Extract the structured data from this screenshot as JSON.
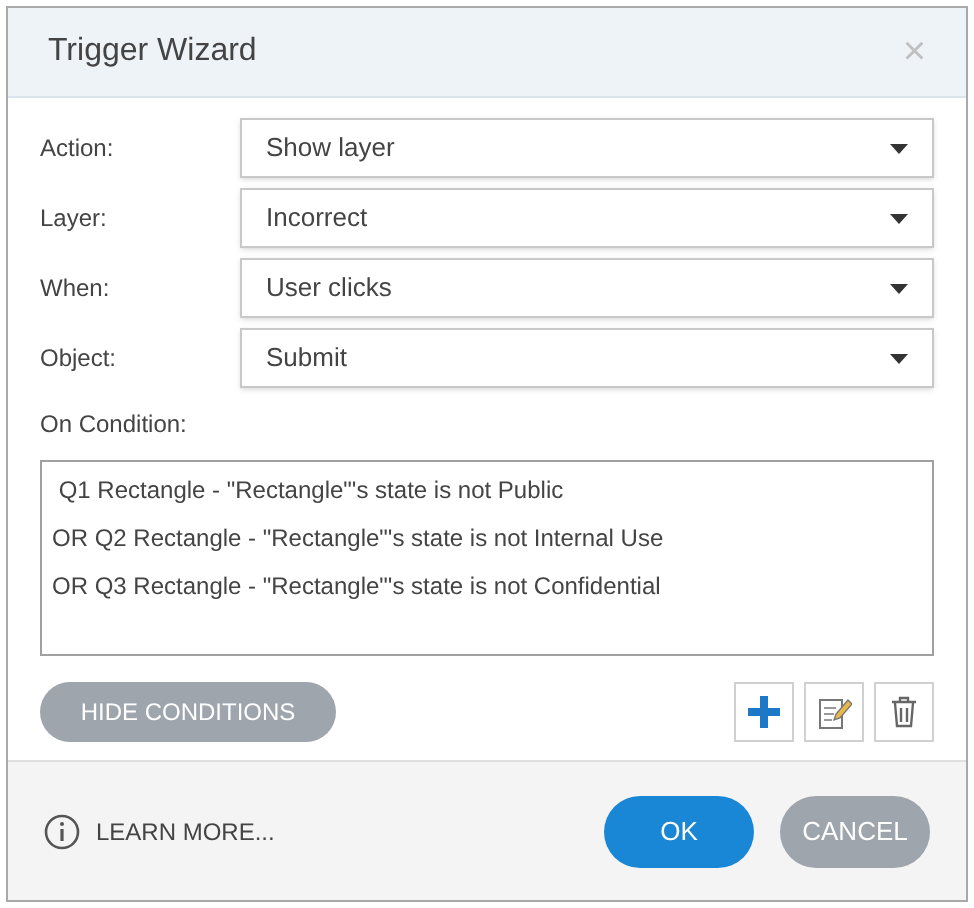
{
  "window": {
    "title": "Trigger Wizard",
    "close": "×"
  },
  "fields": [
    {
      "label": "Action:",
      "value": "Show layer"
    },
    {
      "label": "Layer:",
      "value": "Incorrect"
    },
    {
      "label": "When:",
      "value": "User clicks"
    },
    {
      "label": "Object:",
      "value": "Submit"
    }
  ],
  "conditions": {
    "label": "On Condition:",
    "items": [
      " Q1 Rectangle - \"Rectangle\"'s state is not Public",
      "OR Q2 Rectangle - \"Rectangle\"'s state is not Internal Use",
      "OR Q3 Rectangle - \"Rectangle\"'s state is not Confidential"
    ]
  },
  "hide_conditions": "HIDE CONDITIONS",
  "footer": {
    "learn_more": "LEARN MORE...",
    "ok": "OK",
    "cancel": "CANCEL"
  }
}
